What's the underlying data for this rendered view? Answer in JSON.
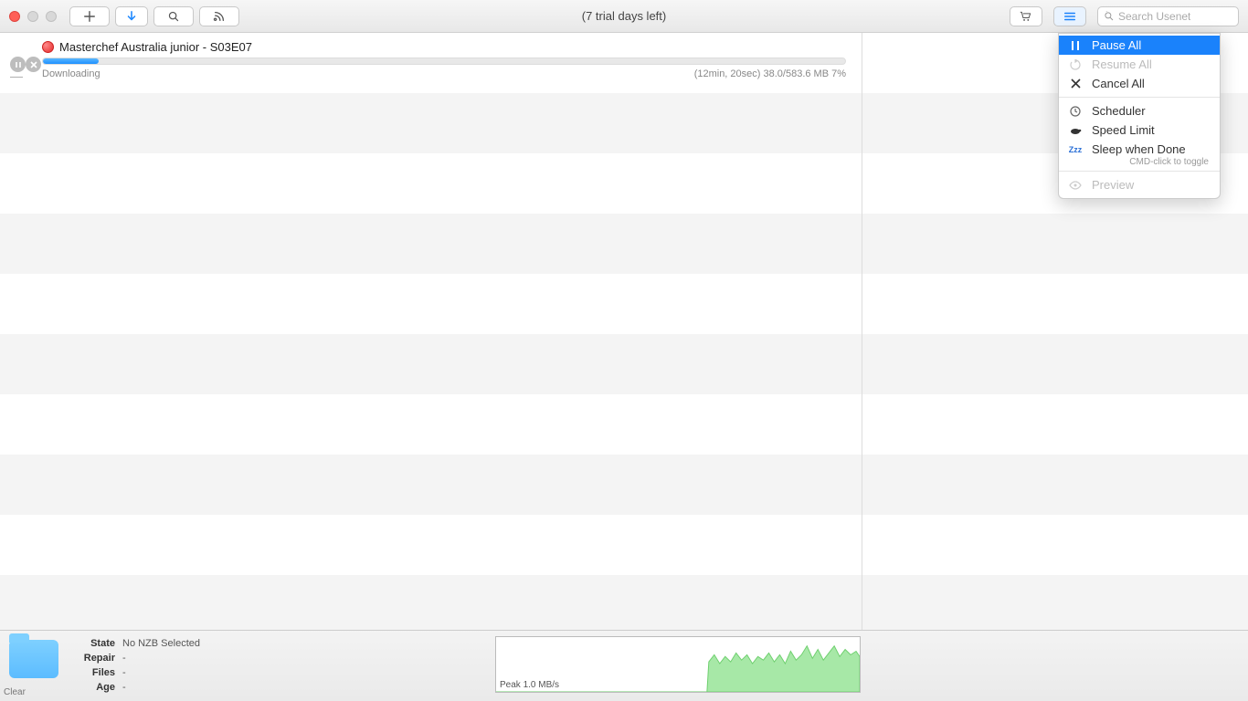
{
  "titlebar": {
    "center_text": "(7 trial days left)",
    "search_placeholder": "Search Usenet"
  },
  "download": {
    "title": "Masterchef Australia junior - S03E07",
    "status": "Downloading",
    "eta_size": "(12min, 20sec) 38.0/583.6 MB  7%",
    "progress_percent": 7
  },
  "menu": {
    "pause_all": "Pause All",
    "resume_all": "Resume All",
    "cancel_all": "Cancel All",
    "scheduler": "Scheduler",
    "speed_limit": "Speed Limit",
    "sleep_when_done": "Sleep when Done",
    "sleep_hint": "CMD-click to toggle",
    "preview": "Preview"
  },
  "bottom": {
    "clear": "Clear",
    "labels": {
      "state": "State",
      "repair": "Repair",
      "files": "Files",
      "age": "Age"
    },
    "values": {
      "state": "No NZB Selected",
      "repair": "-",
      "files": "-",
      "age": "-"
    },
    "graph_label": "Peak 1.0 MB/s"
  }
}
